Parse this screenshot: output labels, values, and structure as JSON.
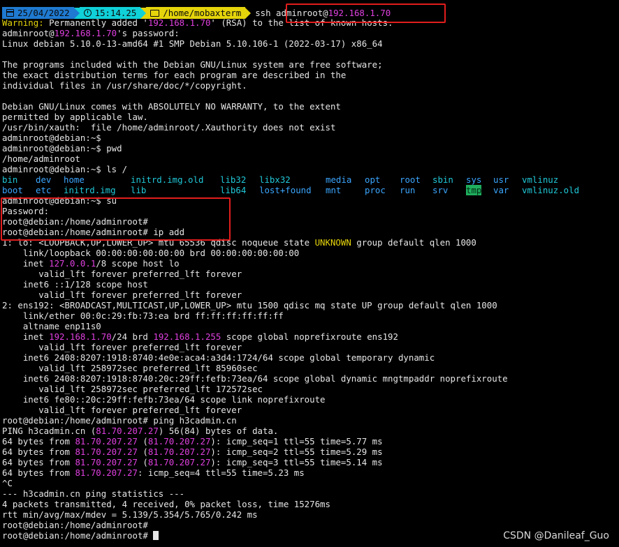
{
  "prompt": {
    "date": "25/04/2022",
    "time": "15:14.25",
    "path": "/home/mobaxterm",
    "command_prefix": "ssh adminroot@",
    "command_host": "192.168.1.70"
  },
  "icons": [
    "calendar-icon",
    "clock-icon",
    "folder-icon"
  ],
  "lines": {
    "l1a": "Warning:",
    "l1b": " Permanently added '",
    "l1c": "192.168.1.70",
    "l1d": "' (RSA) to the list of known hosts.",
    "l2a": "adminroot@",
    "l2b": "192.168.1.70",
    "l2c": "'s password:",
    "l3": "Linux debian 5.10.0-13-amd64 #1 SMP Debian 5.10.106-1 (2022-03-17) x86_64",
    "l4": "",
    "l5": "The programs included with the Debian GNU/Linux system are free software;",
    "l6": "the exact distribution terms for each program are described in the",
    "l7": "individual files in /usr/share/doc/*/copyright.",
    "l8": "",
    "l9": "Debian GNU/Linux comes with ABSOLUTELY NO WARRANTY, to the extent",
    "l10": "permitted by applicable law.",
    "l11": "/usr/bin/xauth:  file /home/adminroot/.Xauthority does not exist",
    "l12": "adminroot@debian:~$",
    "l13": "adminroot@debian:~$ pwd",
    "l14": "/home/adminroot",
    "l15": "adminroot@debian:~$ ls /",
    "ls1": [
      "bin",
      "dev",
      "home",
      "initrd.img.old",
      "lib32",
      "libx32",
      "media",
      "opt",
      "root",
      "sbin",
      "sys",
      "usr",
      "vmlinuz"
    ],
    "ls2": [
      "boot",
      "etc",
      "initrd.img",
      "lib",
      "lib64",
      "lost+found",
      "mnt",
      "proc",
      "run",
      "srv",
      "tmp",
      "var",
      "vmlinuz.old"
    ],
    "l18": "adminroot@debian:~$ su",
    "l19": "Password:",
    "l20": "root@debian:/home/adminroot#",
    "l21": "root@debian:/home/adminroot# ip add",
    "l22a": "1: lo: <LOOPBACK,UP,LOWER_UP> mtu 65536 qdisc noqueue state ",
    "l22b": "UNKNOWN",
    "l22c": " group default qlen 1000",
    "l23": "    link/loopback 00:00:00:00:00:00 brd 00:00:00:00:00:00",
    "l24a": "    inet ",
    "l24b": "127.0.0.1",
    "l24c": "/8 scope host lo",
    "l25": "       valid_lft forever preferred_lft forever",
    "l26": "    inet6 ::1/128 scope host",
    "l27": "       valid_lft forever preferred_lft forever",
    "l28": "2: ens192: <BROADCAST,MULTICAST,UP,LOWER_UP> mtu 1500 qdisc mq state UP group default qlen 1000",
    "l29": "    link/ether 00:0c:29:fb:73:ea brd ff:ff:ff:ff:ff:ff",
    "l30": "    altname enp11s0",
    "l31a": "    inet ",
    "l31b": "192.168.1.70",
    "l31c": "/24 brd ",
    "l31d": "192.168.1.255",
    "l31e": " scope global noprefixroute ens192",
    "l32": "       valid_lft forever preferred_lft forever",
    "l33": "    inet6 2408:8207:1918:8740:4e0e:aca4:a3d4:1724/64 scope global temporary dynamic",
    "l34": "       valid_lft 258972sec preferred_lft 85960sec",
    "l35": "    inet6 2408:8207:1918:8740:20c:29ff:fefb:73ea/64 scope global dynamic mngtmpaddr noprefixroute",
    "l36": "       valid_lft 258972sec preferred_lft 172572sec",
    "l37": "    inet6 fe80::20c:29ff:fefb:73ea/64 scope link noprefixroute",
    "l38": "       valid_lft forever preferred_lft forever",
    "l39": "root@debian:/home/adminroot# ping h3cadmin.cn",
    "l40a": "PING h3cadmin.cn (",
    "l40b": "81.70.207.27",
    "l40c": ") 56(84) bytes of data.",
    "ping_ip": "81.70.207.27",
    "ping_rows": [
      {
        "pre": "64 bytes from ",
        "mid": " (",
        "post": "): icmp_seq=1 ttl=55 time=5.77 ms"
      },
      {
        "pre": "64 bytes from ",
        "mid": " (",
        "post": "): icmp_seq=2 ttl=55 time=5.29 ms"
      },
      {
        "pre": "64 bytes from ",
        "mid": " (",
        "post": "): icmp_seq=3 ttl=55 time=5.14 ms"
      }
    ],
    "l44a": "64 bytes from ",
    "l44c": ": icmp_seq=4 ttl=55 time=5.23 ms",
    "l45": "^C",
    "l46": "--- h3cadmin.cn ping statistics ---",
    "l47": "4 packets transmitted, 4 received, 0% packet loss, time 15276ms",
    "l48": "rtt min/avg/max/mdev = 5.139/5.354/5.765/0.242 ms",
    "l49": "root@debian:/home/adminroot#",
    "l50": "root@debian:/home/adminroot# "
  },
  "watermark": "CSDN @Danileaf_Guo",
  "colors": {
    "highlight_box": "#e21d1d",
    "ip_magenta": "#e040e0",
    "warning_yellow": "#e5d40b",
    "dir_blue": "#3ba6ff",
    "link_cyan": "#20c8d8"
  }
}
